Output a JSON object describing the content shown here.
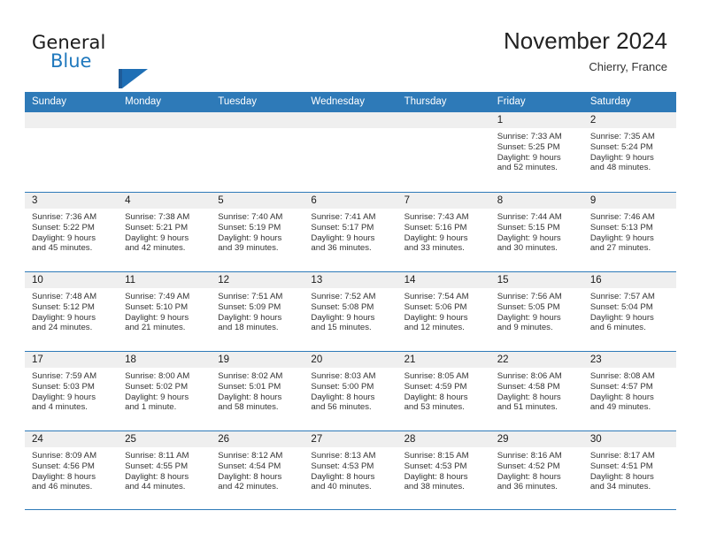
{
  "brand": {
    "line1": "General",
    "line2": "Blue",
    "mark_icon": "triangle-logo-icon",
    "color_primary": "#1f6fb5",
    "color_dark": "#1a1a1a"
  },
  "header": {
    "title": "November 2024",
    "subtitle": "Chierry, France"
  },
  "colors": {
    "header_blue": "#2e7ab8",
    "day_band_gray": "#efefef",
    "text": "#333333"
  },
  "calendar": {
    "weekday_headers": [
      "Sunday",
      "Monday",
      "Tuesday",
      "Wednesday",
      "Thursday",
      "Friday",
      "Saturday"
    ],
    "weeks": [
      [
        {
          "day": "",
          "sunrise": "",
          "sunset": "",
          "daylight_line1": "",
          "daylight_line2": ""
        },
        {
          "day": "",
          "sunrise": "",
          "sunset": "",
          "daylight_line1": "",
          "daylight_line2": ""
        },
        {
          "day": "",
          "sunrise": "",
          "sunset": "",
          "daylight_line1": "",
          "daylight_line2": ""
        },
        {
          "day": "",
          "sunrise": "",
          "sunset": "",
          "daylight_line1": "",
          "daylight_line2": ""
        },
        {
          "day": "",
          "sunrise": "",
          "sunset": "",
          "daylight_line1": "",
          "daylight_line2": ""
        },
        {
          "day": "1",
          "sunrise": "Sunrise: 7:33 AM",
          "sunset": "Sunset: 5:25 PM",
          "daylight_line1": "Daylight: 9 hours",
          "daylight_line2": "and 52 minutes."
        },
        {
          "day": "2",
          "sunrise": "Sunrise: 7:35 AM",
          "sunset": "Sunset: 5:24 PM",
          "daylight_line1": "Daylight: 9 hours",
          "daylight_line2": "and 48 minutes."
        }
      ],
      [
        {
          "day": "3",
          "sunrise": "Sunrise: 7:36 AM",
          "sunset": "Sunset: 5:22 PM",
          "daylight_line1": "Daylight: 9 hours",
          "daylight_line2": "and 45 minutes."
        },
        {
          "day": "4",
          "sunrise": "Sunrise: 7:38 AM",
          "sunset": "Sunset: 5:21 PM",
          "daylight_line1": "Daylight: 9 hours",
          "daylight_line2": "and 42 minutes."
        },
        {
          "day": "5",
          "sunrise": "Sunrise: 7:40 AM",
          "sunset": "Sunset: 5:19 PM",
          "daylight_line1": "Daylight: 9 hours",
          "daylight_line2": "and 39 minutes."
        },
        {
          "day": "6",
          "sunrise": "Sunrise: 7:41 AM",
          "sunset": "Sunset: 5:17 PM",
          "daylight_line1": "Daylight: 9 hours",
          "daylight_line2": "and 36 minutes."
        },
        {
          "day": "7",
          "sunrise": "Sunrise: 7:43 AM",
          "sunset": "Sunset: 5:16 PM",
          "daylight_line1": "Daylight: 9 hours",
          "daylight_line2": "and 33 minutes."
        },
        {
          "day": "8",
          "sunrise": "Sunrise: 7:44 AM",
          "sunset": "Sunset: 5:15 PM",
          "daylight_line1": "Daylight: 9 hours",
          "daylight_line2": "and 30 minutes."
        },
        {
          "day": "9",
          "sunrise": "Sunrise: 7:46 AM",
          "sunset": "Sunset: 5:13 PM",
          "daylight_line1": "Daylight: 9 hours",
          "daylight_line2": "and 27 minutes."
        }
      ],
      [
        {
          "day": "10",
          "sunrise": "Sunrise: 7:48 AM",
          "sunset": "Sunset: 5:12 PM",
          "daylight_line1": "Daylight: 9 hours",
          "daylight_line2": "and 24 minutes."
        },
        {
          "day": "11",
          "sunrise": "Sunrise: 7:49 AM",
          "sunset": "Sunset: 5:10 PM",
          "daylight_line1": "Daylight: 9 hours",
          "daylight_line2": "and 21 minutes."
        },
        {
          "day": "12",
          "sunrise": "Sunrise: 7:51 AM",
          "sunset": "Sunset: 5:09 PM",
          "daylight_line1": "Daylight: 9 hours",
          "daylight_line2": "and 18 minutes."
        },
        {
          "day": "13",
          "sunrise": "Sunrise: 7:52 AM",
          "sunset": "Sunset: 5:08 PM",
          "daylight_line1": "Daylight: 9 hours",
          "daylight_line2": "and 15 minutes."
        },
        {
          "day": "14",
          "sunrise": "Sunrise: 7:54 AM",
          "sunset": "Sunset: 5:06 PM",
          "daylight_line1": "Daylight: 9 hours",
          "daylight_line2": "and 12 minutes."
        },
        {
          "day": "15",
          "sunrise": "Sunrise: 7:56 AM",
          "sunset": "Sunset: 5:05 PM",
          "daylight_line1": "Daylight: 9 hours",
          "daylight_line2": "and 9 minutes."
        },
        {
          "day": "16",
          "sunrise": "Sunrise: 7:57 AM",
          "sunset": "Sunset: 5:04 PM",
          "daylight_line1": "Daylight: 9 hours",
          "daylight_line2": "and 6 minutes."
        }
      ],
      [
        {
          "day": "17",
          "sunrise": "Sunrise: 7:59 AM",
          "sunset": "Sunset: 5:03 PM",
          "daylight_line1": "Daylight: 9 hours",
          "daylight_line2": "and 4 minutes."
        },
        {
          "day": "18",
          "sunrise": "Sunrise: 8:00 AM",
          "sunset": "Sunset: 5:02 PM",
          "daylight_line1": "Daylight: 9 hours",
          "daylight_line2": "and 1 minute."
        },
        {
          "day": "19",
          "sunrise": "Sunrise: 8:02 AM",
          "sunset": "Sunset: 5:01 PM",
          "daylight_line1": "Daylight: 8 hours",
          "daylight_line2": "and 58 minutes."
        },
        {
          "day": "20",
          "sunrise": "Sunrise: 8:03 AM",
          "sunset": "Sunset: 5:00 PM",
          "daylight_line1": "Daylight: 8 hours",
          "daylight_line2": "and 56 minutes."
        },
        {
          "day": "21",
          "sunrise": "Sunrise: 8:05 AM",
          "sunset": "Sunset: 4:59 PM",
          "daylight_line1": "Daylight: 8 hours",
          "daylight_line2": "and 53 minutes."
        },
        {
          "day": "22",
          "sunrise": "Sunrise: 8:06 AM",
          "sunset": "Sunset: 4:58 PM",
          "daylight_line1": "Daylight: 8 hours",
          "daylight_line2": "and 51 minutes."
        },
        {
          "day": "23",
          "sunrise": "Sunrise: 8:08 AM",
          "sunset": "Sunset: 4:57 PM",
          "daylight_line1": "Daylight: 8 hours",
          "daylight_line2": "and 49 minutes."
        }
      ],
      [
        {
          "day": "24",
          "sunrise": "Sunrise: 8:09 AM",
          "sunset": "Sunset: 4:56 PM",
          "daylight_line1": "Daylight: 8 hours",
          "daylight_line2": "and 46 minutes."
        },
        {
          "day": "25",
          "sunrise": "Sunrise: 8:11 AM",
          "sunset": "Sunset: 4:55 PM",
          "daylight_line1": "Daylight: 8 hours",
          "daylight_line2": "and 44 minutes."
        },
        {
          "day": "26",
          "sunrise": "Sunrise: 8:12 AM",
          "sunset": "Sunset: 4:54 PM",
          "daylight_line1": "Daylight: 8 hours",
          "daylight_line2": "and 42 minutes."
        },
        {
          "day": "27",
          "sunrise": "Sunrise: 8:13 AM",
          "sunset": "Sunset: 4:53 PM",
          "daylight_line1": "Daylight: 8 hours",
          "daylight_line2": "and 40 minutes."
        },
        {
          "day": "28",
          "sunrise": "Sunrise: 8:15 AM",
          "sunset": "Sunset: 4:53 PM",
          "daylight_line1": "Daylight: 8 hours",
          "daylight_line2": "and 38 minutes."
        },
        {
          "day": "29",
          "sunrise": "Sunrise: 8:16 AM",
          "sunset": "Sunset: 4:52 PM",
          "daylight_line1": "Daylight: 8 hours",
          "daylight_line2": "and 36 minutes."
        },
        {
          "day": "30",
          "sunrise": "Sunrise: 8:17 AM",
          "sunset": "Sunset: 4:51 PM",
          "daylight_line1": "Daylight: 8 hours",
          "daylight_line2": "and 34 minutes."
        }
      ]
    ]
  }
}
